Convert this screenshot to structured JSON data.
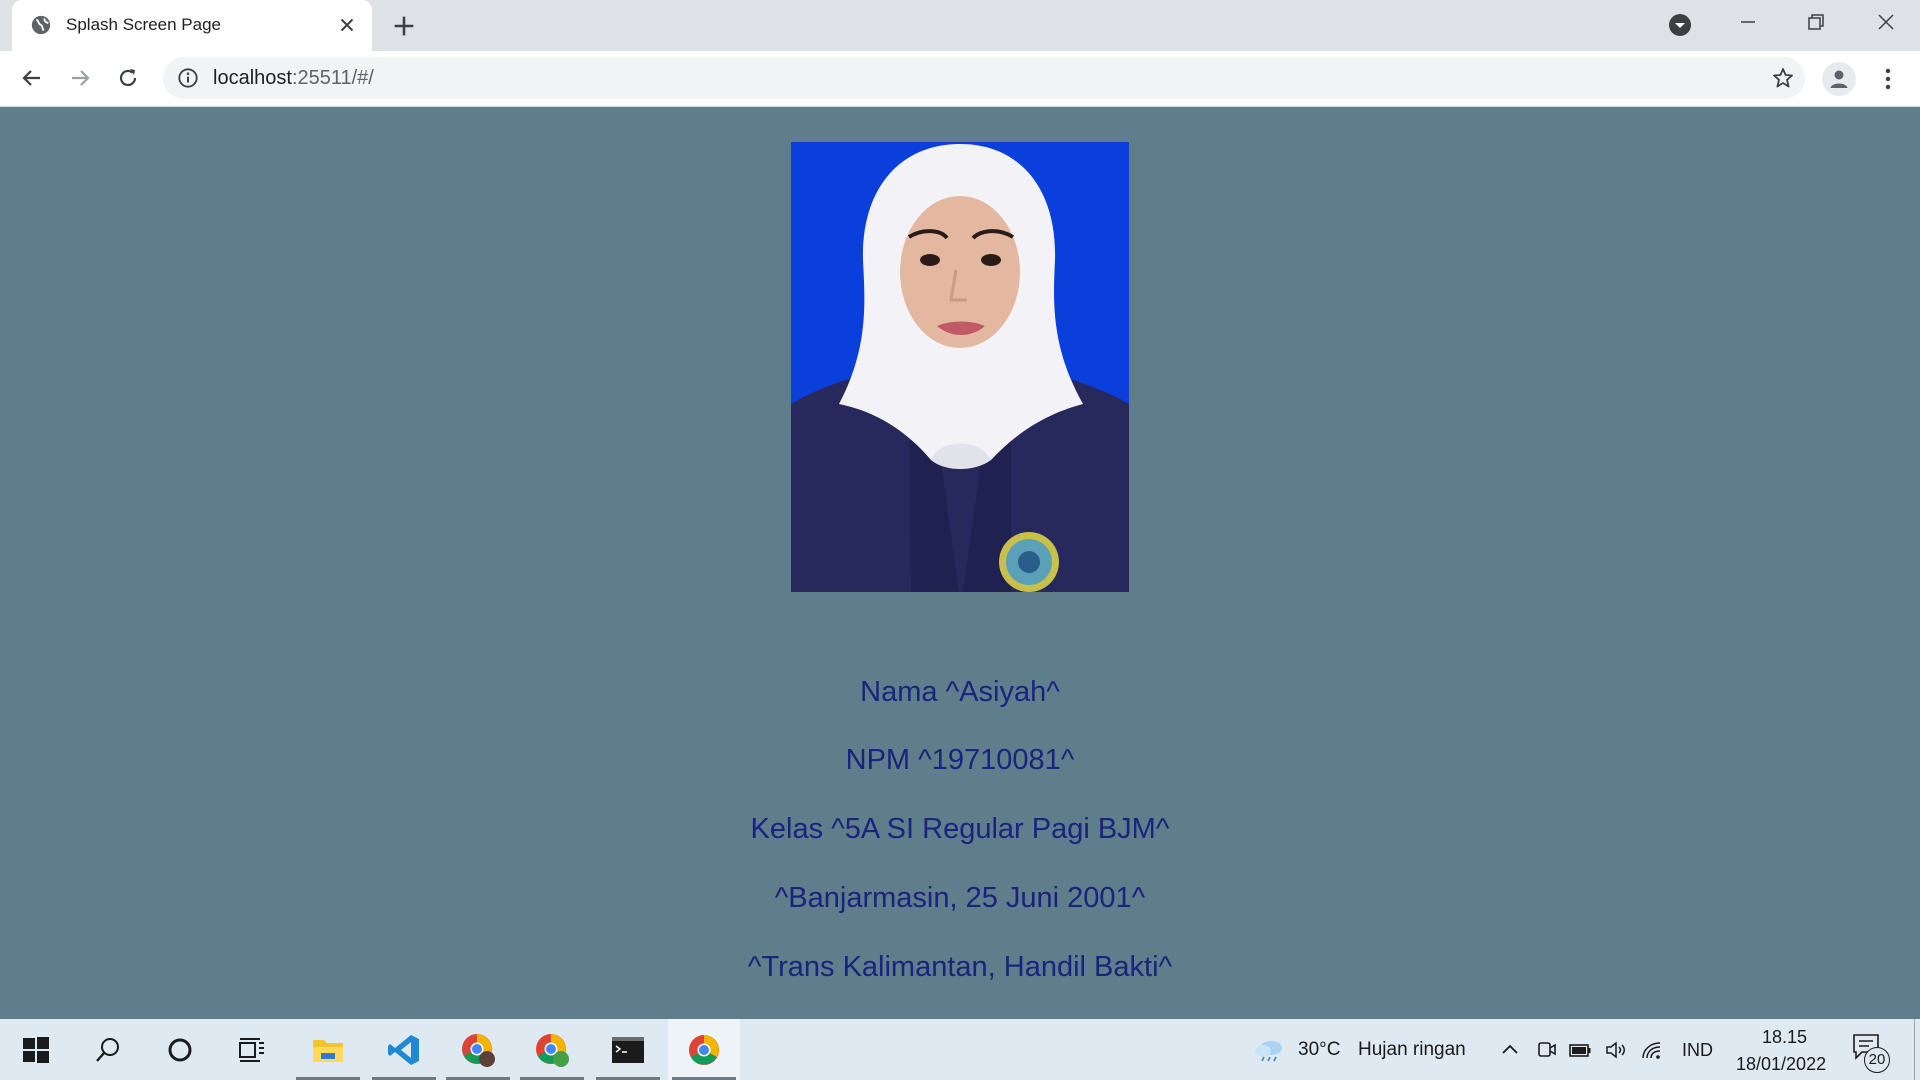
{
  "browser": {
    "tab_title": "Splash Screen Page",
    "url_host": "localhost",
    "url_rest": ":25511/#/"
  },
  "page": {
    "photo_alt": "",
    "lines": [
      "Nama ^Asiyah^",
      "NPM ^19710081^",
      "Kelas ^5A SI Regular Pagi BJM^",
      "^Banjarmasin, 25 Juni 2001^",
      "^Trans Kalimantan, Handil Bakti^"
    ]
  },
  "taskbar": {
    "weather": {
      "temp": "30°C",
      "desc": "Hujan ringan"
    },
    "language": "IND",
    "time": "18.15",
    "date": "18/01/2022",
    "notifications": "20"
  },
  "colors": {
    "page_bg": "#607d8b",
    "text": "#1a237e",
    "photo_bg": "#0a3fdc"
  }
}
